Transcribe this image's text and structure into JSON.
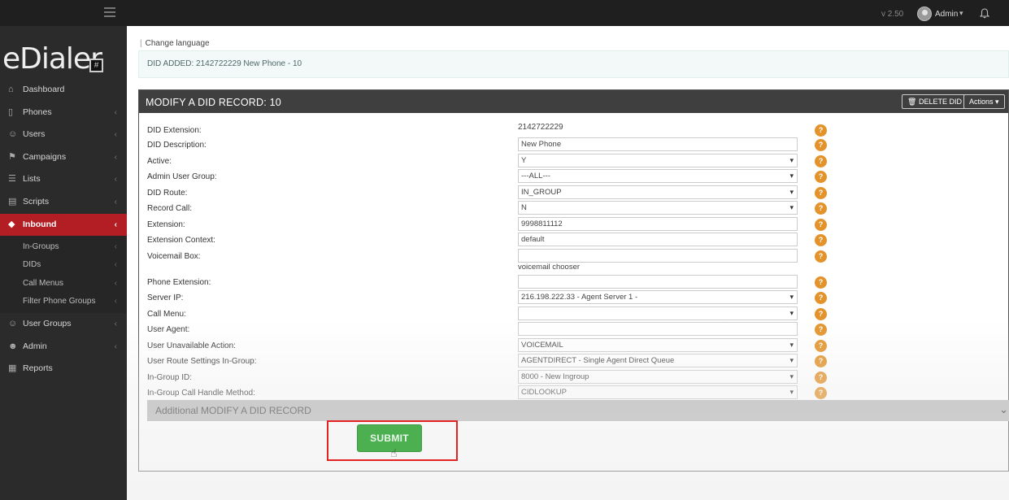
{
  "topbar": {
    "version": "v 2.50",
    "user": "Admin"
  },
  "sidebar": {
    "logo_text": "eDialer",
    "logo_badge": "#",
    "items": [
      {
        "label": "Dashboard",
        "icon": "home-icon"
      },
      {
        "label": "Phones",
        "icon": "phone-icon"
      },
      {
        "label": "Users",
        "icon": "users-icon"
      },
      {
        "label": "Campaigns",
        "icon": "flag-icon"
      },
      {
        "label": "Lists",
        "icon": "list-icon"
      },
      {
        "label": "Scripts",
        "icon": "script-icon"
      },
      {
        "label": "Inbound",
        "icon": "diamond-icon",
        "active": true
      },
      {
        "label": "User Groups",
        "icon": "user-group-icon"
      },
      {
        "label": "Admin",
        "icon": "admin-icon"
      },
      {
        "label": "Reports",
        "icon": "report-icon"
      }
    ],
    "inbound_sub": [
      {
        "label": "In-Groups"
      },
      {
        "label": "DIDs"
      },
      {
        "label": "Call Menus"
      },
      {
        "label": "Filter Phone Groups"
      }
    ]
  },
  "main": {
    "change_language": "Change language",
    "alert": "DID ADDED: 2142722229 New Phone - 10",
    "panel": {
      "title": "MODIFY A DID RECORD: 10",
      "delete_label": "DELETE DID",
      "actions_label": "Actions"
    },
    "fields": [
      {
        "label": "DID Extension:",
        "type": "static",
        "value": "2142722229"
      },
      {
        "label": "DID Description:",
        "type": "text",
        "value": "New Phone"
      },
      {
        "label": "Active:",
        "type": "select",
        "value": "Y"
      },
      {
        "label": "Admin User Group:",
        "type": "select",
        "value": "---ALL---"
      },
      {
        "label": "DID Route:",
        "type": "select",
        "value": "IN_GROUP"
      },
      {
        "label": "Record Call:",
        "type": "select",
        "value": "N"
      },
      {
        "label": "Extension:",
        "type": "text",
        "value": "9998811112"
      },
      {
        "label": "Extension Context:",
        "type": "text",
        "value": "default"
      },
      {
        "label": "Voicemail Box:",
        "type": "text",
        "value": ""
      },
      {
        "label": "Phone Extension:",
        "type": "text",
        "value": ""
      },
      {
        "label": "Server IP:",
        "type": "select",
        "value": "216.198.222.33 - Agent Server 1 -"
      },
      {
        "label": "Call Menu:",
        "type": "select",
        "value": ""
      },
      {
        "label": "User Agent:",
        "type": "text",
        "value": ""
      },
      {
        "label": "User Unavailable Action:",
        "type": "select",
        "value": "VOICEMAIL"
      },
      {
        "label": "User Route Settings In-Group:",
        "type": "select",
        "value": "AGENTDIRECT - Single Agent Direct Queue"
      },
      {
        "label": "In-Group ID:",
        "type": "select",
        "value": "8000 - New Ingroup"
      },
      {
        "label": "In-Group Call Handle Method:",
        "type": "select",
        "value": "CIDLOOKUP"
      }
    ],
    "voicemail_chooser": "voicemail chooser",
    "help_glyph": "?",
    "additional_section": "Additional MODIFY A DID RECORD",
    "submit_label": "SUBMIT"
  }
}
